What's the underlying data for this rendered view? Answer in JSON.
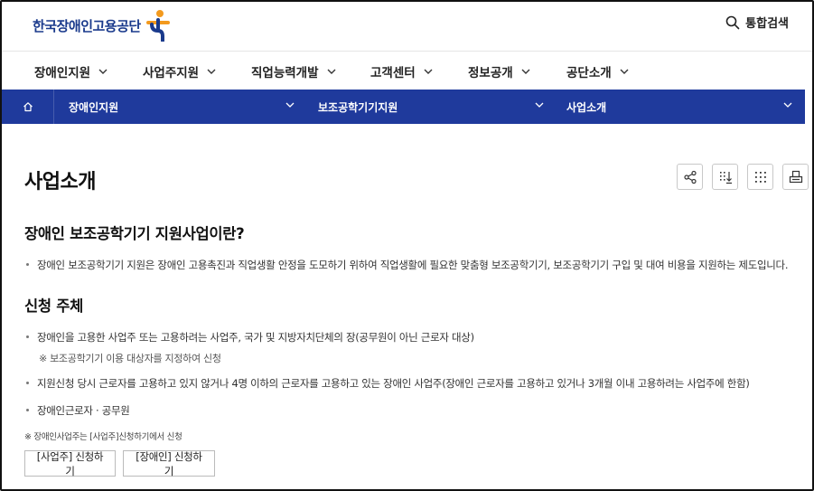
{
  "header": {
    "logo_text": "한국장애인고용공단",
    "search_label": "통합검색"
  },
  "gnb": {
    "items": [
      {
        "label": "장애인지원"
      },
      {
        "label": "사업주지원"
      },
      {
        "label": "직업능력개발"
      },
      {
        "label": "고객센터"
      },
      {
        "label": "정보공개"
      },
      {
        "label": "공단소개"
      }
    ]
  },
  "location": {
    "items": [
      {
        "label": "장애인지원"
      },
      {
        "label": "보조공학기기지원"
      },
      {
        "label": "사업소개"
      }
    ]
  },
  "page": {
    "title": "사업소개",
    "tools": [
      {
        "icon": "share-icon"
      },
      {
        "icon": "download-icon"
      },
      {
        "icon": "grid-dots-icon"
      },
      {
        "icon": "print-icon"
      }
    ]
  },
  "content": {
    "section1": {
      "heading": "장애인 보조공학기기 지원사업이란?",
      "bullets": [
        "장애인 보조공학기기 지원은 장애인 고용촉진과 직업생활 안정을 도모하기 위하여 직업생활에 필요한 맞춤형 보조공학기기, 보조공학기기 구입 및 대여 비용을 지원하는 제도입니다."
      ]
    },
    "section2": {
      "heading": "신청 주체",
      "bullet1": "장애인을 고용한 사업주 또는 고용하려는 사업주, 국가 및 지방자치단체의 장(공무원이 아닌 근로자 대상)",
      "bullet1_sub": "※ 보조공학기기 이용 대상자를 지정하여 신청",
      "bullet2": "지원신청 당시 근로자를 고용하고 있지 않거나 4명 이하의 근로자를 고용하고 있는 장애인 사업주(장애인 근로자를 고용하고 있거나 3개월 이내 고용하려는 사업주에 한함)",
      "bullet3": "장애인근로자 · 공무원",
      "note": "※ 장애인사업주는 [사업주]신청하기에서 신청"
    },
    "buttons": {
      "employer": "[사업주] 신청하기",
      "disabled": "[장애인] 신청하기"
    }
  },
  "colors": {
    "brand_blue": "#1f3a9c",
    "logo_orange": "#f39a1e",
    "logo_blue": "#1a3a8c"
  }
}
